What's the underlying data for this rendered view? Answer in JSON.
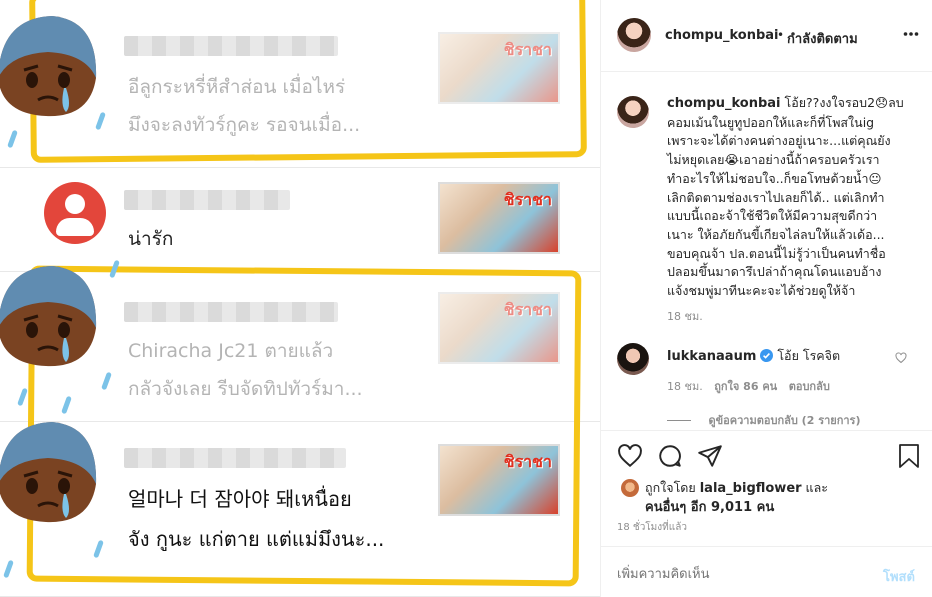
{
  "photo": {
    "comments": [
      {
        "text1": "อีลูกระหรี่หีสำส่อน เมื่อไหร่",
        "text2": "มึงจะลงทัวร์กูคะ รอจนเมื่อ...",
        "thumb_label": "ชิราชา"
      },
      {
        "text1": "น่ารัก",
        "thumb_label": "ชิราชา"
      },
      {
        "text1": "Chiracha Jc21 ตายแล้ว",
        "text2": "กลัวจังเลย รีบจัดทิปทัวร์มา...",
        "thumb_label": "ชิราชา"
      },
      {
        "text1": "얼마나 더 잠아야 돼เหนื่อย",
        "text2": "จัง กูนะ แก่ตาย แต่แม่มึงนะ...",
        "thumb_label": "ชิราชา"
      }
    ]
  },
  "header": {
    "username": "chompu_konbai",
    "separator": "•",
    "follow_status": "กำลังติดตาม",
    "more_icon": "more-horizontal-icon"
  },
  "caption": {
    "username": "chompu_konbai",
    "lines": [
      "โอ้ย??งงใจรอบ2😞ลบ",
      "คอมเม้นในยูทูปออกให้และก็ที่โพสในig",
      "เพราะจะได้ต่างคนต่างอยู่เนาะ...แต่คุณยัง",
      "ไม่หยุดเลย😭เอาอย่างนี้ถ้าครอบครัวเรา",
      "ทำอะไรให้ไม่ชอบใจ..ก็ขอโทษด้วยน้ำ😐",
      "เลิกติดตามช่องเราไปเลยก็ได้.. แต่เลิกทำ",
      "แบบนี้เถอะจ้าใช้ชีวิตให้มีความสุขดีกว่า",
      "เนาะ ให้อภัยกันขี้เกียจไล่ลบให้แล้วเด้อ...",
      "ขอบคุณจ้า ปล.ตอนนี้ไม่รู้ว่าเป็นคนทำชื่อ",
      "ปลอมขึ้นมาดารึเปล่าถ้าคุณโดนแอบอ้าง",
      "แจ้งชมพู่มาทีนะคะจะได้ช่วยดูให้จ้า"
    ],
    "time": "18 ชม."
  },
  "reply": {
    "username": "lukkanaaum",
    "verified_icon": "verified-badge-icon",
    "text": "โอ้ย โรคจิต",
    "time": "18 ชม.",
    "likes": "ถูกใจ 86 คน",
    "reply_label": "ตอบกลับ",
    "view_replies": "ดูข้อความตอบกลับ (2 รายการ)",
    "heart_icon": "heart-outline-icon"
  },
  "actions": {
    "like_icon": "heart-icon",
    "comment_icon": "comment-icon",
    "share_icon": "send-icon",
    "save_icon": "bookmark-icon"
  },
  "likes": {
    "prefix": "ถูกใจโดย",
    "user": "lala_bigflower",
    "and": "และ",
    "others": "คนอื่นๆ อีก 9,011 คน"
  },
  "timestamp": "18 ชั่วโมงที่แล้ว",
  "add_comment": {
    "placeholder": "เพิ่มความคิดเห็น",
    "post_label": "โพสต์"
  },
  "colors": {
    "highlight": "#f5c518",
    "link": "#b2dffc",
    "muted": "#8e8e8e",
    "verified": "#3897f0"
  }
}
